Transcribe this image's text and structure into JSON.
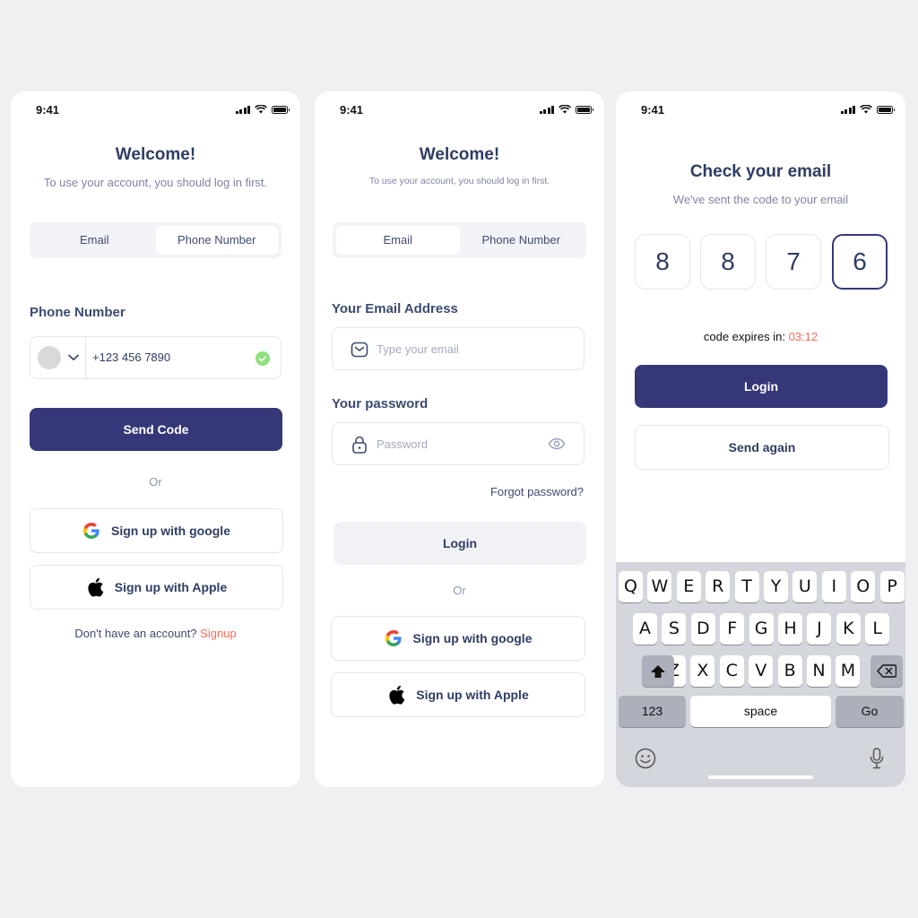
{
  "status_time": "9:41",
  "login_phone": {
    "title": "Welcome!",
    "subtitle": "To use your account, you should log in first.",
    "tabs": [
      "Email",
      "Phone Number"
    ],
    "field_label": "Phone Number",
    "phone_value": "+123 456 7890",
    "send_code": "Send Code",
    "or": "Or",
    "google": "Sign up with google",
    "apple": "Sign up with Apple",
    "no_account": "Don't have an account?",
    "signup": "Signup"
  },
  "login_email": {
    "title": "Welcome!",
    "subtitle": "To use your account, you should log in first.",
    "tabs": [
      "Email",
      "Phone Number"
    ],
    "email_label": "Your Email Address",
    "email_placeholder": "Type your email",
    "password_label": "Your password",
    "password_placeholder": "Password",
    "forgot": "Forgot password?",
    "login": "Login",
    "or": "Or",
    "google": "Sign up with google",
    "apple": "Sign up with Apple"
  },
  "verify": {
    "title": "Check your email",
    "subtitle": "We've sent the code to your email",
    "digits": [
      "8",
      "8",
      "7",
      "6"
    ],
    "expires_label": "code expires in:",
    "expires_time": "03:12",
    "login": "Login",
    "send_again": "Send again"
  },
  "keyboard": {
    "row1": [
      "Q",
      "W",
      "E",
      "R",
      "T",
      "Y",
      "U",
      "I",
      "O",
      "P"
    ],
    "row2": [
      "A",
      "S",
      "D",
      "F",
      "G",
      "H",
      "J",
      "K",
      "L"
    ],
    "row3": [
      "Z",
      "X",
      "C",
      "V",
      "B",
      "N",
      "M"
    ],
    "numbers": "123",
    "space": "space",
    "go": "Go"
  },
  "colors": {
    "primary": "#353778",
    "text": "#2f3d63",
    "accent_red": "#f26b5b",
    "success": "#8ee07b",
    "background": "#eff0f2"
  }
}
